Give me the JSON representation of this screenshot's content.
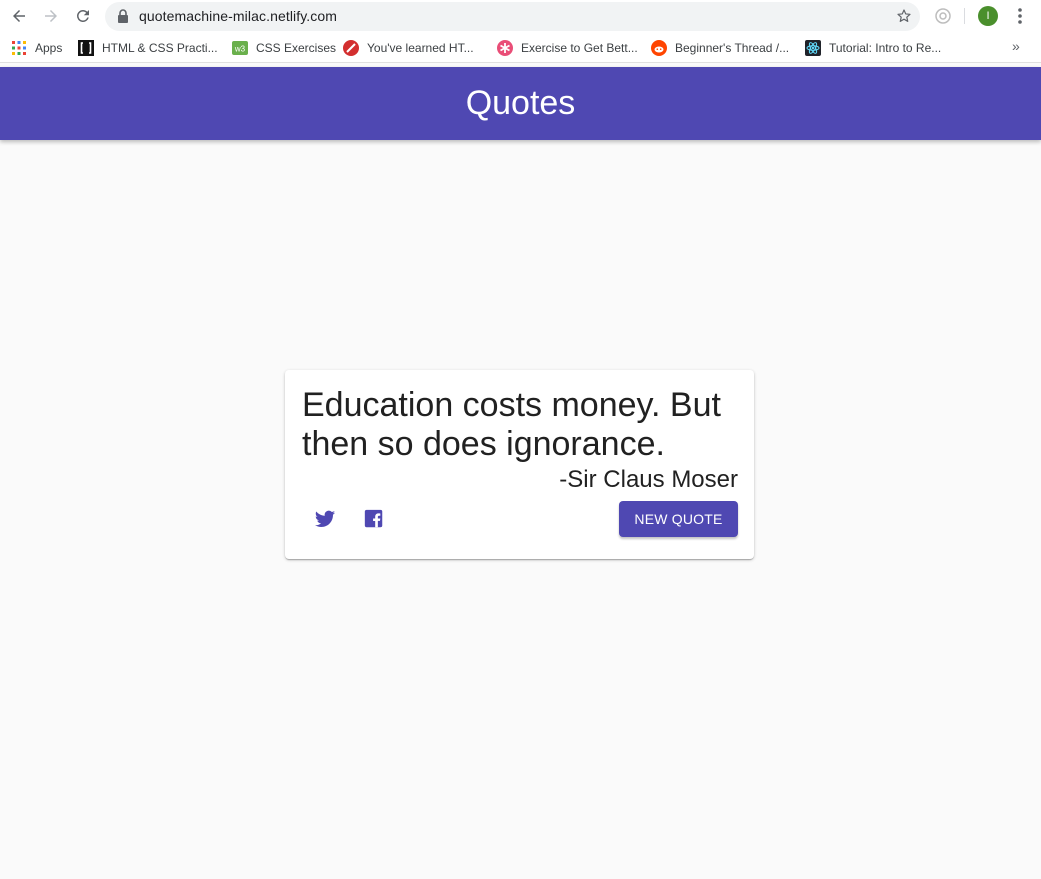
{
  "browser": {
    "url": "quotemachine-milac.netlify.com",
    "profile_initial": "I",
    "bookmarks": [
      {
        "label": "Apps",
        "icon": "apps-grid-icon"
      },
      {
        "label": "HTML & CSS Practi...",
        "icon": "brackets-icon"
      },
      {
        "label": "CSS Exercises",
        "icon": "w3-icon"
      },
      {
        "label": "You've learned HT...",
        "icon": "red-circle-icon"
      },
      {
        "label": "Exercise to Get Bett...",
        "icon": "pink-asterisk-icon"
      },
      {
        "label": "Beginner's Thread /...",
        "icon": "reddit-icon"
      },
      {
        "label": "Tutorial: Intro to Re...",
        "icon": "react-icon"
      }
    ],
    "more_label": "»"
  },
  "header": {
    "title": "Quotes",
    "color": "#4f48b2"
  },
  "quote": {
    "text": "Education costs money. But then so does ignorance.",
    "author": "-Sir Claus Moser",
    "new_quote_label": "NEW QUOTE",
    "icon_color": "#4f48b2"
  }
}
